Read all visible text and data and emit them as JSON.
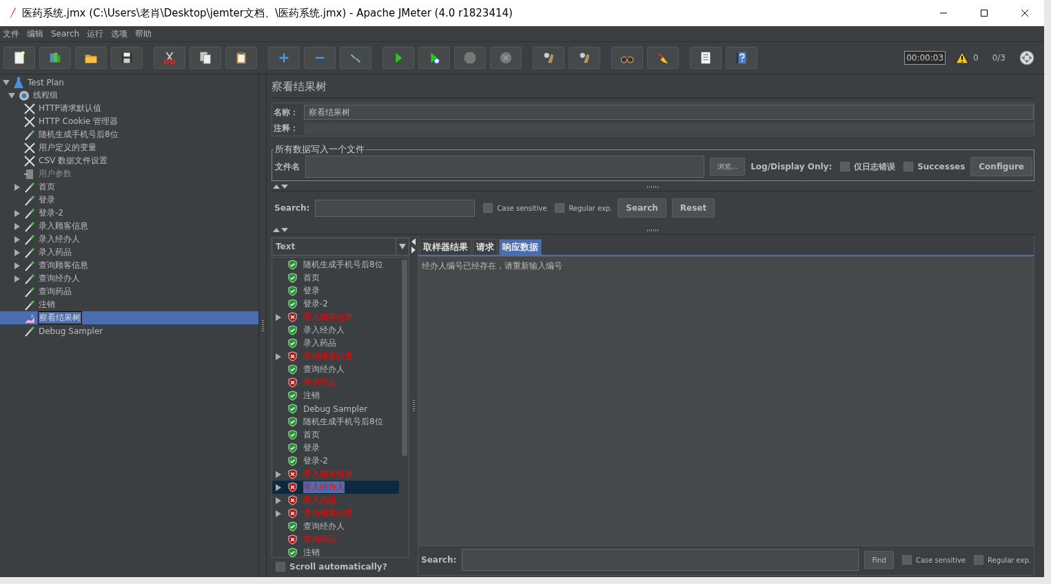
{
  "window": {
    "title": "医药系统.jmx (C:\\Users\\老肖\\Desktop\\jemter文档、\\医药系统.jmx) - Apache JMeter (4.0 r1823414)"
  },
  "menu": [
    {
      "label": "文件"
    },
    {
      "label": "编辑"
    },
    {
      "label": "Search"
    },
    {
      "label": "运行"
    },
    {
      "label": "选项"
    },
    {
      "label": "帮助"
    }
  ],
  "status": {
    "timer": "00:00:03",
    "warnings": "0",
    "threads": "0/3"
  },
  "test_tree": [
    {
      "label": "Test Plan",
      "kind": "plan",
      "expanded": true,
      "selected": false,
      "disabled": false,
      "children": [
        {
          "label": "线程组",
          "kind": "threadgroup",
          "expanded": true,
          "selected": false,
          "disabled": false,
          "children": [
            {
              "label": "HTTP请求默认值",
              "kind": "config",
              "selected": false,
              "disabled": false
            },
            {
              "label": "HTTP Cookie 管理器",
              "kind": "config",
              "selected": false,
              "disabled": false
            },
            {
              "label": "随机生成手机号后8位",
              "kind": "sampler",
              "selected": false,
              "disabled": false
            },
            {
              "label": "用户定义的变量",
              "kind": "config",
              "selected": false,
              "disabled": false
            },
            {
              "label": "CSV 数据文件设置",
              "kind": "config",
              "selected": false,
              "disabled": false
            },
            {
              "label": "用户参数",
              "kind": "preprocessor",
              "selected": false,
              "disabled": true
            },
            {
              "label": "首页",
              "kind": "sampler",
              "expanded": false,
              "selected": false,
              "disabled": false
            },
            {
              "label": "登录",
              "kind": "sampler",
              "selected": false,
              "disabled": false
            },
            {
              "label": "登录-2",
              "kind": "sampler",
              "expanded": false,
              "selected": false,
              "disabled": false
            },
            {
              "label": "录入顾客信息",
              "kind": "sampler",
              "expanded": false,
              "selected": false,
              "disabled": false
            },
            {
              "label": "录入经办人",
              "kind": "sampler",
              "expanded": false,
              "selected": false,
              "disabled": false
            },
            {
              "label": "录入药品",
              "kind": "sampler",
              "expanded": false,
              "selected": false,
              "disabled": false
            },
            {
              "label": "查询顾客信息",
              "kind": "sampler",
              "expanded": false,
              "selected": false,
              "disabled": false
            },
            {
              "label": "查询经办人",
              "kind": "sampler",
              "expanded": false,
              "selected": false,
              "disabled": false
            },
            {
              "label": "查询药品",
              "kind": "sampler",
              "selected": false,
              "disabled": false
            },
            {
              "label": "注销",
              "kind": "sampler",
              "selected": false,
              "disabled": false
            },
            {
              "label": "察看结果树",
              "kind": "listener",
              "selected": true,
              "disabled": false
            },
            {
              "label": "Debug Sampler",
              "kind": "sampler",
              "selected": false,
              "disabled": false
            }
          ]
        }
      ]
    }
  ],
  "panel": {
    "title": "察看结果树",
    "name_label": "名称：",
    "name_value": "察看结果树",
    "comment_label": "注释：",
    "file_group": {
      "legend": "所有数据写入一个文件",
      "file_label": "文件名",
      "browse": "浏览...",
      "log_label": "Log/Display Only:",
      "options": [
        {
          "label": "仅日志错误",
          "checked": false
        },
        {
          "label": "Successes",
          "checked": false
        }
      ],
      "configure": "Configure"
    },
    "search": {
      "label": "Search:",
      "options": [
        {
          "label": "Case sensitive",
          "checked": false
        },
        {
          "label": "Regular exp.",
          "checked": false
        }
      ],
      "search_button": "Search",
      "reset_button": "Reset"
    }
  },
  "renderer": "Text",
  "results": [
    {
      "label": "随机生成手机号后8位",
      "passed": true,
      "selected": false
    },
    {
      "label": "首页",
      "passed": true,
      "selected": false
    },
    {
      "label": "登录",
      "passed": true,
      "selected": false
    },
    {
      "label": "登录-2",
      "passed": true,
      "selected": false
    },
    {
      "label": "录入顾客信息",
      "passed": false,
      "expanded": false,
      "selected": false
    },
    {
      "label": "录入经办人",
      "passed": true,
      "selected": false
    },
    {
      "label": "录入药品",
      "passed": true,
      "selected": false
    },
    {
      "label": "查询顾客信息",
      "passed": false,
      "expanded": false,
      "selected": false
    },
    {
      "label": "查询经办人",
      "passed": true,
      "selected": false
    },
    {
      "label": "查询药品",
      "passed": false,
      "selected": false
    },
    {
      "label": "注销",
      "passed": true,
      "selected": false
    },
    {
      "label": "Debug Sampler",
      "passed": true,
      "selected": false
    },
    {
      "label": "随机生成手机号后8位",
      "passed": true,
      "selected": false
    },
    {
      "label": "首页",
      "passed": true,
      "selected": false
    },
    {
      "label": "登录",
      "passed": true,
      "selected": false
    },
    {
      "label": "登录-2",
      "passed": true,
      "selected": false
    },
    {
      "label": "录入顾客信息",
      "passed": false,
      "expanded": false,
      "selected": false
    },
    {
      "label": "录入经办人",
      "passed": false,
      "expanded": false,
      "selected": true
    },
    {
      "label": "录入药品",
      "passed": false,
      "expanded": false,
      "selected": false
    },
    {
      "label": "查询顾客信息",
      "passed": false,
      "expanded": false,
      "selected": false
    },
    {
      "label": "查询经办人",
      "passed": true,
      "selected": false
    },
    {
      "label": "查询药品",
      "passed": false,
      "selected": false
    },
    {
      "label": "注销",
      "passed": true,
      "selected": false
    }
  ],
  "scroll_auto": {
    "label": "Scroll automatically?",
    "checked": false
  },
  "tabs": [
    {
      "label": "取样器结果",
      "selected": false
    },
    {
      "label": "请求",
      "selected": false
    },
    {
      "label": "响应数据",
      "selected": true
    }
  ],
  "response_text": "经办人编号已经存在，请重新输入编号",
  "bottom_search": {
    "label": "Search:",
    "find": "Find",
    "options": [
      {
        "label": "Case sensitive",
        "checked": false
      },
      {
        "label": "Regular exp.",
        "checked": false
      }
    ]
  }
}
